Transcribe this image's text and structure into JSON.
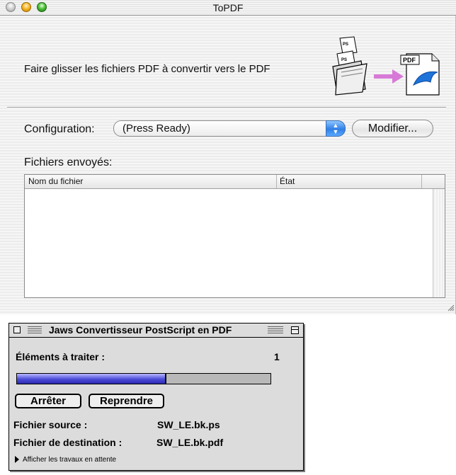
{
  "topdf_window": {
    "title": "ToPDF",
    "instruction": "Faire glisser les fichiers PDF à convertir vers le PDF",
    "badge_pdf": "PDF",
    "badge_ps": "PS",
    "configuration_label": "Configuration:",
    "configuration_value": "(Press Ready)",
    "modify_button": "Modifier...",
    "files_sent_label": "Fichiers envoyés:",
    "table": {
      "columns": [
        "Nom du fichier",
        "État"
      ],
      "rows": []
    },
    "icons": [
      "close-button",
      "minimize-button",
      "zoom-button",
      "folder-icon",
      "arrow-icon",
      "pdf-document-icon",
      "grow-box-icon"
    ]
  },
  "jaws_window": {
    "title": "Jaws Convertisseur PostScript en PDF",
    "items_label": "Éléments à traiter :",
    "items_count": "1",
    "progress_fraction": 0.59,
    "stop_button": "Arrêter",
    "resume_button": "Reprendre",
    "source_label": "Fichier source :",
    "source_value": "SW_LE.bk.ps",
    "dest_label": "Fichier de destination :",
    "dest_value": "SW_LE.bk.pdf",
    "show_queue": "Afficher les travaux en attente",
    "accent_colors": {
      "progress": "#4b4bd9"
    }
  }
}
